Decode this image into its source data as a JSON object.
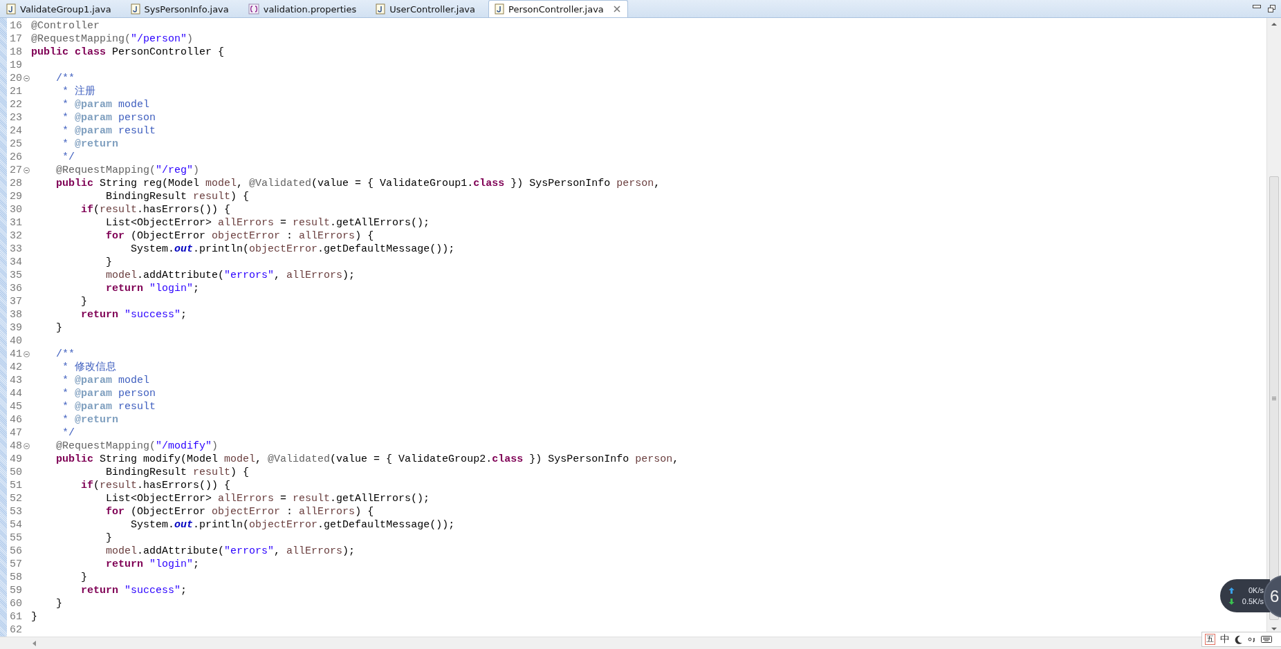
{
  "tabs": [
    {
      "label": "ValidateGroup1.java",
      "kind": "java",
      "selected": false
    },
    {
      "label": "SysPersonInfo.java",
      "kind": "java",
      "selected": false
    },
    {
      "label": "validation.properties",
      "kind": "properties",
      "selected": false
    },
    {
      "label": "UserController.java",
      "kind": "java",
      "selected": false
    },
    {
      "label": "PersonController.java",
      "kind": "java",
      "selected": true
    }
  ],
  "editor": {
    "lines": [
      {
        "number": "16",
        "foldable": false,
        "tokens": [
          {
            "text": "@Controller",
            "kind": "ann"
          }
        ]
      },
      {
        "number": "17",
        "foldable": false,
        "tokens": [
          {
            "text": "@RequestMapping(",
            "kind": "ann"
          },
          {
            "text": "\"/person\"",
            "kind": "str"
          },
          {
            "text": ")",
            "kind": "ann"
          }
        ]
      },
      {
        "number": "18",
        "foldable": false,
        "tokens": [
          {
            "text": "public class",
            "kind": "kw"
          },
          {
            "text": " PersonController {",
            "kind": "plain"
          }
        ]
      },
      {
        "number": "19",
        "foldable": false
      },
      {
        "number": "20",
        "foldable": true,
        "tokens": [
          {
            "text": "    /**",
            "kind": "doc"
          }
        ]
      },
      {
        "number": "21",
        "foldable": false,
        "tokens": [
          {
            "text": "     * 注册",
            "kind": "doc"
          }
        ]
      },
      {
        "number": "22",
        "foldable": false,
        "tokens": [
          {
            "text": "     * ",
            "kind": "doc"
          },
          {
            "text": "@param",
            "kind": "tag"
          },
          {
            "text": " model",
            "kind": "doc"
          }
        ]
      },
      {
        "number": "23",
        "foldable": false,
        "tokens": [
          {
            "text": "     * ",
            "kind": "doc"
          },
          {
            "text": "@param",
            "kind": "tag"
          },
          {
            "text": " person",
            "kind": "doc"
          }
        ]
      },
      {
        "number": "24",
        "foldable": false,
        "tokens": [
          {
            "text": "     * ",
            "kind": "doc"
          },
          {
            "text": "@param",
            "kind": "tag"
          },
          {
            "text": " result",
            "kind": "doc"
          }
        ]
      },
      {
        "number": "25",
        "foldable": false,
        "tokens": [
          {
            "text": "     * ",
            "kind": "doc"
          },
          {
            "text": "@return",
            "kind": "tag"
          }
        ]
      },
      {
        "number": "26",
        "foldable": false,
        "tokens": [
          {
            "text": "     */",
            "kind": "doc"
          }
        ]
      },
      {
        "number": "27",
        "foldable": true,
        "tokens": [
          {
            "text": "    @RequestMapping(",
            "kind": "ann"
          },
          {
            "text": "\"/reg\"",
            "kind": "str"
          },
          {
            "text": ")",
            "kind": "ann"
          }
        ]
      },
      {
        "number": "28",
        "foldable": false,
        "tokens": [
          {
            "text": "    public",
            "kind": "kw"
          },
          {
            "text": " String reg(Model ",
            "kind": "plain"
          },
          {
            "text": "model",
            "kind": "var"
          },
          {
            "text": ", ",
            "kind": "plain"
          },
          {
            "text": "@Validated",
            "kind": "ann"
          },
          {
            "text": "(value = { ValidateGroup1.",
            "kind": "plain"
          },
          {
            "text": "class",
            "kind": "kw"
          },
          {
            "text": " }) SysPersonInfo ",
            "kind": "plain"
          },
          {
            "text": "person",
            "kind": "var"
          },
          {
            "text": ",",
            "kind": "plain"
          }
        ]
      },
      {
        "number": "29",
        "foldable": false,
        "tokens": [
          {
            "text": "            BindingResult ",
            "kind": "plain"
          },
          {
            "text": "result",
            "kind": "var"
          },
          {
            "text": ") {",
            "kind": "plain"
          }
        ]
      },
      {
        "number": "30",
        "foldable": false,
        "tokens": [
          {
            "text": "        if",
            "kind": "kw"
          },
          {
            "text": "(",
            "kind": "plain"
          },
          {
            "text": "result",
            "kind": "var"
          },
          {
            "text": ".hasErrors()) {",
            "kind": "plain"
          }
        ]
      },
      {
        "number": "31",
        "foldable": false,
        "tokens": [
          {
            "text": "            List<ObjectError> ",
            "kind": "plain"
          },
          {
            "text": "allErrors",
            "kind": "var"
          },
          {
            "text": " = ",
            "kind": "plain"
          },
          {
            "text": "result",
            "kind": "var"
          },
          {
            "text": ".getAllErrors();",
            "kind": "plain"
          }
        ]
      },
      {
        "number": "32",
        "foldable": false,
        "tokens": [
          {
            "text": "            for",
            "kind": "kw"
          },
          {
            "text": " (ObjectError ",
            "kind": "plain"
          },
          {
            "text": "objectError",
            "kind": "var"
          },
          {
            "text": " : ",
            "kind": "plain"
          },
          {
            "text": "allErrors",
            "kind": "var"
          },
          {
            "text": ") {",
            "kind": "plain"
          }
        ]
      },
      {
        "number": "33",
        "foldable": false,
        "tokens": [
          {
            "text": "                System.",
            "kind": "plain"
          },
          {
            "text": "out",
            "kind": "static"
          },
          {
            "text": ".println(",
            "kind": "plain"
          },
          {
            "text": "objectError",
            "kind": "var"
          },
          {
            "text": ".getDefaultMessage());",
            "kind": "plain"
          }
        ]
      },
      {
        "number": "34",
        "foldable": false,
        "tokens": [
          {
            "text": "            }",
            "kind": "plain"
          }
        ]
      },
      {
        "number": "35",
        "foldable": false,
        "tokens": [
          {
            "text": "            model",
            "kind": "var"
          },
          {
            "text": ".addAttribute(",
            "kind": "plain"
          },
          {
            "text": "\"errors\"",
            "kind": "str"
          },
          {
            "text": ", ",
            "kind": "plain"
          },
          {
            "text": "allErrors",
            "kind": "var"
          },
          {
            "text": ");",
            "kind": "plain"
          }
        ]
      },
      {
        "number": "36",
        "foldable": false,
        "tokens": [
          {
            "text": "            return",
            "kind": "kw"
          },
          {
            "text": " \"login\"",
            "kind": "str"
          },
          {
            "text": ";",
            "kind": "plain"
          }
        ]
      },
      {
        "number": "37",
        "foldable": false,
        "tokens": [
          {
            "text": "        }",
            "kind": "plain"
          }
        ]
      },
      {
        "number": "38",
        "foldable": false,
        "tokens": [
          {
            "text": "        return",
            "kind": "kw"
          },
          {
            "text": " \"success\"",
            "kind": "str"
          },
          {
            "text": ";",
            "kind": "plain"
          }
        ]
      },
      {
        "number": "39",
        "foldable": false,
        "tokens": [
          {
            "text": "    }",
            "kind": "plain"
          }
        ]
      },
      {
        "number": "40",
        "foldable": false
      },
      {
        "number": "41",
        "foldable": true,
        "tokens": [
          {
            "text": "    /**",
            "kind": "doc"
          }
        ]
      },
      {
        "number": "42",
        "foldable": false,
        "tokens": [
          {
            "text": "     * 修改信息",
            "kind": "doc"
          }
        ]
      },
      {
        "number": "43",
        "foldable": false,
        "tokens": [
          {
            "text": "     * ",
            "kind": "doc"
          },
          {
            "text": "@param",
            "kind": "tag"
          },
          {
            "text": " model",
            "kind": "doc"
          }
        ]
      },
      {
        "number": "44",
        "foldable": false,
        "tokens": [
          {
            "text": "     * ",
            "kind": "doc"
          },
          {
            "text": "@param",
            "kind": "tag"
          },
          {
            "text": " person",
            "kind": "doc"
          }
        ]
      },
      {
        "number": "45",
        "foldable": false,
        "tokens": [
          {
            "text": "     * ",
            "kind": "doc"
          },
          {
            "text": "@param",
            "kind": "tag"
          },
          {
            "text": " result",
            "kind": "doc"
          }
        ]
      },
      {
        "number": "46",
        "foldable": false,
        "tokens": [
          {
            "text": "     * ",
            "kind": "doc"
          },
          {
            "text": "@return",
            "kind": "tag"
          }
        ]
      },
      {
        "number": "47",
        "foldable": false,
        "tokens": [
          {
            "text": "     */",
            "kind": "doc"
          }
        ]
      },
      {
        "number": "48",
        "foldable": true,
        "tokens": [
          {
            "text": "    @RequestMapping(",
            "kind": "ann"
          },
          {
            "text": "\"/modify\"",
            "kind": "str"
          },
          {
            "text": ")",
            "kind": "ann"
          }
        ]
      },
      {
        "number": "49",
        "foldable": false,
        "tokens": [
          {
            "text": "    public",
            "kind": "kw"
          },
          {
            "text": " String modify(Model ",
            "kind": "plain"
          },
          {
            "text": "model",
            "kind": "var"
          },
          {
            "text": ", ",
            "kind": "plain"
          },
          {
            "text": "@Validated",
            "kind": "ann"
          },
          {
            "text": "(value = { ValidateGroup2.",
            "kind": "plain"
          },
          {
            "text": "class",
            "kind": "kw"
          },
          {
            "text": " }) SysPersonInfo ",
            "kind": "plain"
          },
          {
            "text": "person",
            "kind": "var"
          },
          {
            "text": ",",
            "kind": "plain"
          }
        ]
      },
      {
        "number": "50",
        "foldable": false,
        "tokens": [
          {
            "text": "            BindingResult ",
            "kind": "plain"
          },
          {
            "text": "result",
            "kind": "var"
          },
          {
            "text": ") {",
            "kind": "plain"
          }
        ]
      },
      {
        "number": "51",
        "foldable": false,
        "tokens": [
          {
            "text": "        if",
            "kind": "kw"
          },
          {
            "text": "(",
            "kind": "plain"
          },
          {
            "text": "result",
            "kind": "var"
          },
          {
            "text": ".hasErrors()) {",
            "kind": "plain"
          }
        ]
      },
      {
        "number": "52",
        "foldable": false,
        "tokens": [
          {
            "text": "            List<ObjectError> ",
            "kind": "plain"
          },
          {
            "text": "allErrors",
            "kind": "var"
          },
          {
            "text": " = ",
            "kind": "plain"
          },
          {
            "text": "result",
            "kind": "var"
          },
          {
            "text": ".getAllErrors();",
            "kind": "plain"
          }
        ]
      },
      {
        "number": "53",
        "foldable": false,
        "tokens": [
          {
            "text": "            for",
            "kind": "kw"
          },
          {
            "text": " (ObjectError ",
            "kind": "plain"
          },
          {
            "text": "objectError",
            "kind": "var"
          },
          {
            "text": " : ",
            "kind": "plain"
          },
          {
            "text": "allErrors",
            "kind": "var"
          },
          {
            "text": ") {",
            "kind": "plain"
          }
        ]
      },
      {
        "number": "54",
        "foldable": false,
        "tokens": [
          {
            "text": "                System.",
            "kind": "plain"
          },
          {
            "text": "out",
            "kind": "static"
          },
          {
            "text": ".println(",
            "kind": "plain"
          },
          {
            "text": "objectError",
            "kind": "var"
          },
          {
            "text": ".getDefaultMessage());",
            "kind": "plain"
          }
        ]
      },
      {
        "number": "55",
        "foldable": false,
        "tokens": [
          {
            "text": "            }",
            "kind": "plain"
          }
        ]
      },
      {
        "number": "56",
        "foldable": false,
        "tokens": [
          {
            "text": "            model",
            "kind": "var"
          },
          {
            "text": ".addAttribute(",
            "kind": "plain"
          },
          {
            "text": "\"errors\"",
            "kind": "str"
          },
          {
            "text": ", ",
            "kind": "plain"
          },
          {
            "text": "allErrors",
            "kind": "var"
          },
          {
            "text": ");",
            "kind": "plain"
          }
        ]
      },
      {
        "number": "57",
        "foldable": false,
        "tokens": [
          {
            "text": "            return",
            "kind": "kw"
          },
          {
            "text": " \"login\"",
            "kind": "str"
          },
          {
            "text": ";",
            "kind": "plain"
          }
        ]
      },
      {
        "number": "58",
        "foldable": false,
        "tokens": [
          {
            "text": "        }",
            "kind": "plain"
          }
        ]
      },
      {
        "number": "59",
        "foldable": false,
        "tokens": [
          {
            "text": "        return",
            "kind": "kw"
          },
          {
            "text": " \"success\"",
            "kind": "str"
          },
          {
            "text": ";",
            "kind": "plain"
          }
        ]
      },
      {
        "number": "60",
        "foldable": false,
        "tokens": [
          {
            "text": "    }",
            "kind": "plain"
          }
        ]
      },
      {
        "number": "61",
        "foldable": false,
        "tokens": [
          {
            "text": "}",
            "kind": "plain"
          }
        ]
      },
      {
        "number": "62",
        "foldable": false
      }
    ]
  },
  "network_widget": {
    "upload": "0K/s",
    "download": "0.5K/s",
    "badge": "6"
  },
  "ime_bar": {
    "layout": "五",
    "mode": "中"
  }
}
